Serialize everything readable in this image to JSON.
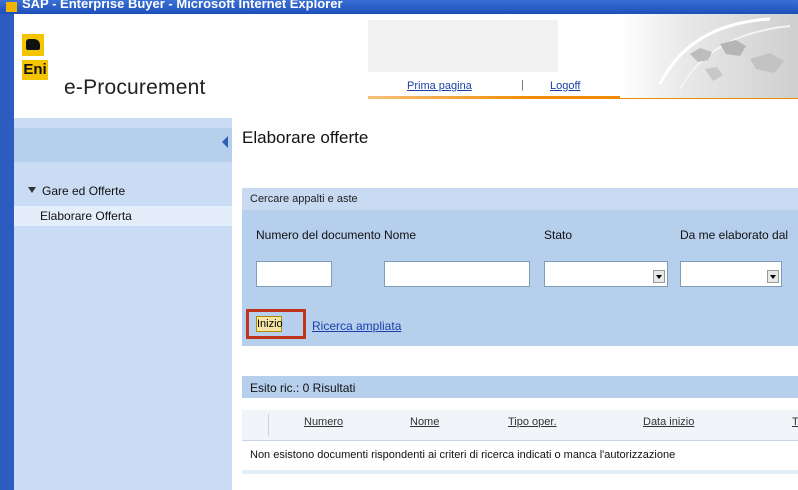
{
  "window": {
    "title": "SAP - Enterprise Buyer - Microsoft Internet Explorer"
  },
  "header": {
    "brand": "e-Procurement",
    "logo_text": "Eni",
    "nav": {
      "home": "Prima pagina",
      "separator": "|",
      "logoff": "Logoff"
    }
  },
  "sidebar": {
    "section": "Gare ed Offerte",
    "items": [
      {
        "label": "Elaborare Offerta"
      }
    ]
  },
  "page": {
    "title": "Elaborare offerte"
  },
  "search": {
    "panel_title": "Cercare appalti e aste",
    "fields": {
      "numero_label": "Numero del documento",
      "numero_value": "",
      "nome_label": "Nome",
      "nome_value": "",
      "stato_label": "Stato",
      "stato_value": "",
      "elaborato_label": "Da me elaborato dal",
      "elaborato_value": ""
    },
    "start_button": "Inizio",
    "advanced_link": "Ricerca ampliata"
  },
  "results": {
    "header": "Esito ric.: 0 Risultati",
    "columns": [
      "Numero",
      "Nome",
      "Tipo oper.",
      "Data inizio",
      "T"
    ],
    "empty_message": "Non esistono documenti rispondenti ai criteri di ricerca indicati o manca l'autorizzazione"
  },
  "colors": {
    "sidebar": "#c9dcf3",
    "panel": "#b6cfed",
    "accent": "#f08a00",
    "highlight": "#c0341c",
    "link": "#1a3fa8"
  }
}
